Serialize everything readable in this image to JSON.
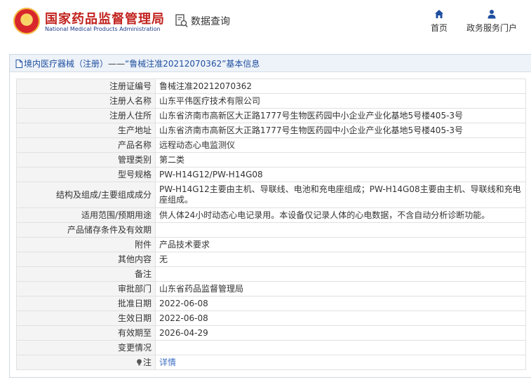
{
  "header": {
    "site_title": "国家药品监督管理局",
    "site_subtitle": "National Medical Products Administration",
    "data_query": "数据查询",
    "nav": {
      "home": "首页",
      "portal": "政务服务门户"
    }
  },
  "breadcrumb": {
    "category": "境内医疗器械（注册）",
    "separator": "——",
    "title": "“鲁械注准20212070362”基本信息"
  },
  "rows": [
    {
      "label": "注册证编号",
      "value": "鲁械注准20212070362"
    },
    {
      "label": "注册人名称",
      "value": "山东平伟医疗技术有限公司"
    },
    {
      "label": "注册人住所",
      "value": "山东省济南市高新区大正路1777号生物医药园中小企业产业化基地5号楼405-3号"
    },
    {
      "label": "生产地址",
      "value": "山东省济南市高新区大正路1777号生物医药园中小企业产业化基地5号楼405-3号"
    },
    {
      "label": "产品名称",
      "value": "远程动态心电监测仪"
    },
    {
      "label": "管理类别",
      "value": "第二类"
    },
    {
      "label": "型号规格",
      "value": "PW-H14G12/PW-H14G08"
    },
    {
      "label": "结构及组成/主要组成成分",
      "value": "PW-H14G12主要由主机、导联线、电池和充电座组成；PW-H14G08主要由主机、导联线和充电座组成。"
    },
    {
      "label": "适用范围/预期用途",
      "value": "供人体24小时动态心电记录用。本设备仅记录人体的心电数据，不含自动分析诊断功能。"
    },
    {
      "label": "产品储存条件及有效期",
      "value": ""
    },
    {
      "label": "附件",
      "value": "产品技术要求"
    },
    {
      "label": "其他内容",
      "value": "无"
    },
    {
      "label": "备注",
      "value": ""
    },
    {
      "label": "审批部门",
      "value": "山东省药品监督管理局"
    },
    {
      "label": "批准日期",
      "value": "2022-06-08"
    },
    {
      "label": "生效日期",
      "value": "2022-06-08"
    },
    {
      "label": "有效期至",
      "value": "2026-04-29"
    },
    {
      "label": "变更情况",
      "value": ""
    }
  ],
  "note": {
    "label": "注",
    "link": "详情",
    "icon": "lightbulb-icon"
  },
  "colors": {
    "brand_red": "#c2231f",
    "link_blue": "#3f6fc4",
    "label_bg": "#f4f4f4",
    "panel_head_bg": "#eef3f9"
  }
}
